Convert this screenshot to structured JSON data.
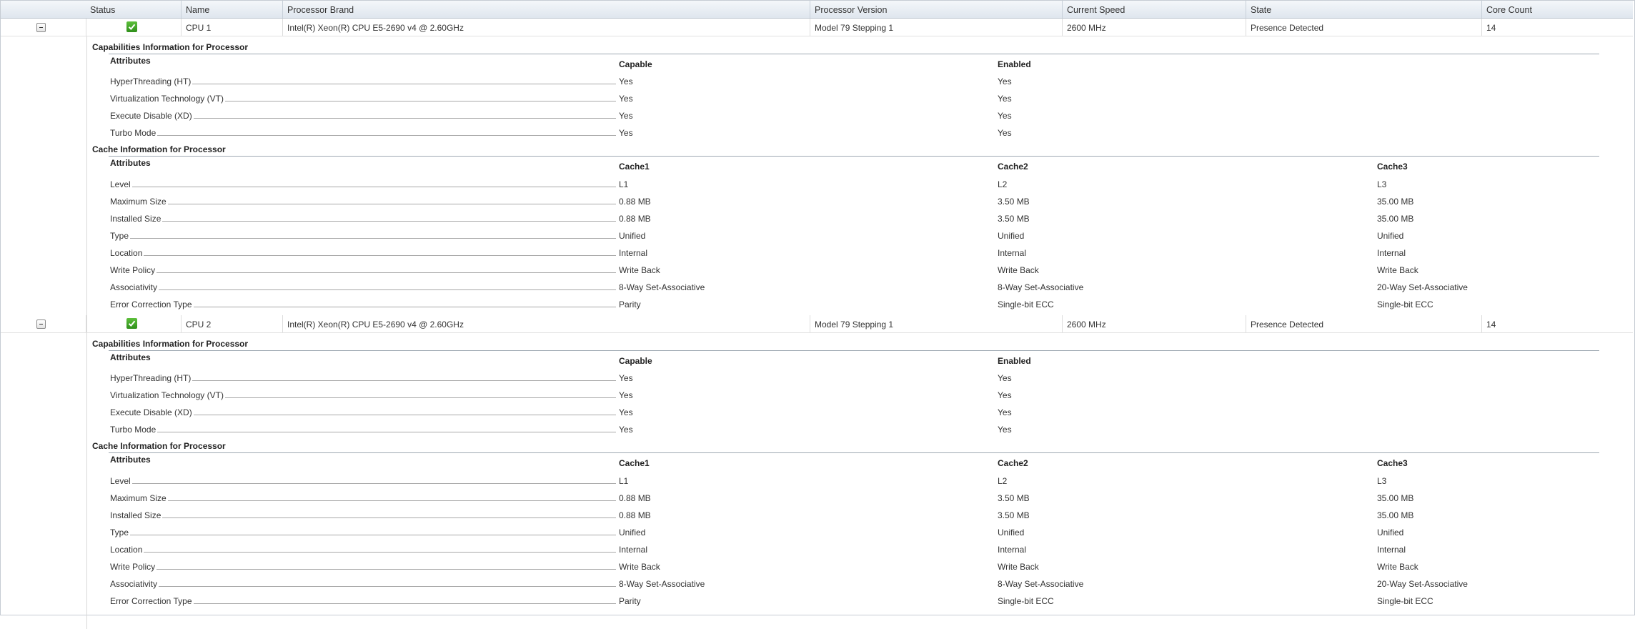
{
  "table": {
    "columns": [
      "Status",
      "Name",
      "Processor Brand",
      "Processor Version",
      "Current Speed",
      "State",
      "Core Count"
    ],
    "expand_symbol": "−",
    "processors": [
      {
        "name": "CPU 1",
        "brand": "Intel(R) Xeon(R) CPU E5-2690 v4 @ 2.60GHz",
        "version": "Model 79 Stepping 1",
        "speed": "2600 MHz",
        "state": "Presence Detected",
        "core_count": "14",
        "status_icon": "check-ok-icon"
      },
      {
        "name": "CPU 2",
        "brand": "Intel(R) Xeon(R) CPU E5-2690 v4 @ 2.60GHz",
        "version": "Model 79 Stepping 1",
        "speed": "2600 MHz",
        "state": "Presence Detected",
        "core_count": "14",
        "status_icon": "check-ok-icon"
      }
    ]
  },
  "capabilities": {
    "title": "Capabilities Information for Processor",
    "attributes_header": "Attributes",
    "capable_header": "Capable",
    "enabled_header": "Enabled",
    "rows": [
      {
        "label": "HyperThreading (HT)",
        "capable": "Yes",
        "enabled": "Yes"
      },
      {
        "label": "Virtualization Technology (VT)",
        "capable": "Yes",
        "enabled": "Yes"
      },
      {
        "label": "Execute Disable (XD)",
        "capable": "Yes",
        "enabled": "Yes"
      },
      {
        "label": "Turbo Mode",
        "capable": "Yes",
        "enabled": "Yes"
      }
    ]
  },
  "cache": {
    "title": "Cache Information for Processor",
    "attributes_header": "Attributes",
    "headers": [
      "Cache1",
      "Cache2",
      "Cache3"
    ],
    "rows": [
      {
        "label": "Level",
        "values": [
          "L1",
          "L2",
          "L3"
        ]
      },
      {
        "label": "Maximum Size",
        "values": [
          "0.88 MB",
          "3.50 MB",
          "35.00 MB"
        ]
      },
      {
        "label": "Installed Size",
        "values": [
          "0.88 MB",
          "3.50 MB",
          "35.00 MB"
        ]
      },
      {
        "label": "Type",
        "values": [
          "Unified",
          "Unified",
          "Unified"
        ]
      },
      {
        "label": "Location",
        "values": [
          "Internal",
          "Internal",
          "Internal"
        ]
      },
      {
        "label": "Write Policy",
        "values": [
          "Write Back",
          "Write Back",
          "Write Back"
        ]
      },
      {
        "label": "Associativity",
        "values": [
          "8-Way Set-Associative",
          "8-Way Set-Associative",
          "20-Way Set-Associative"
        ]
      },
      {
        "label": "Error Correction Type",
        "values": [
          "Parity",
          "Single-bit ECC",
          "Single-bit ECC"
        ]
      }
    ]
  },
  "colors": {
    "header_bg": "#e3e9ef",
    "status_ok": "#3aa52a",
    "divider": "#9ea8b2"
  }
}
